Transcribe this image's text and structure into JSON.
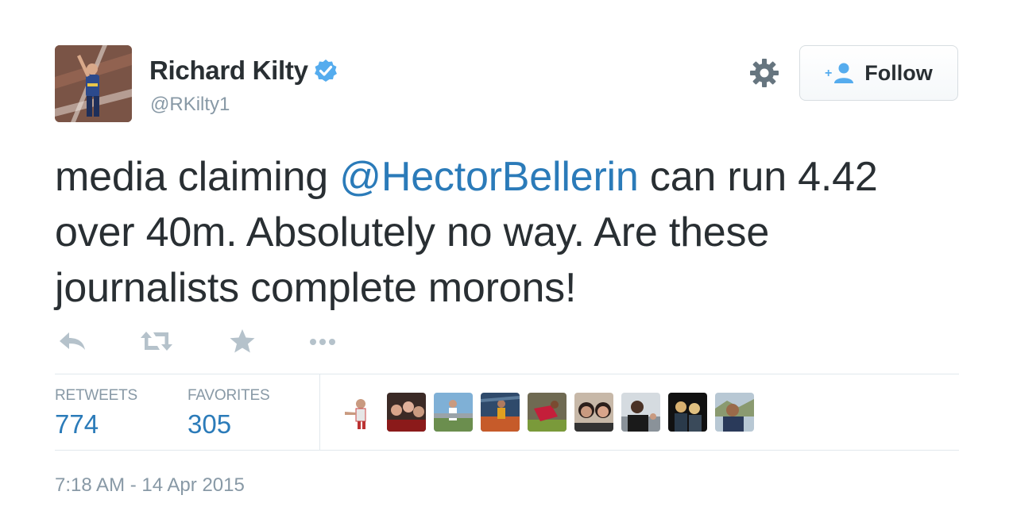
{
  "user": {
    "name": "Richard Kilty",
    "handle": "@RKilty1"
  },
  "follow_button": {
    "label": "Follow"
  },
  "tweet": {
    "text_before": "media claiming ",
    "mention": "@HectorBellerin",
    "text_after": " can run 4.42 over 40m. Absolutely no way. Are these journalists complete morons!"
  },
  "actions": [
    {
      "icon": "reply-icon"
    },
    {
      "icon": "retweet-icon"
    },
    {
      "icon": "favorite-star-icon"
    },
    {
      "icon": "more-options-icon"
    }
  ],
  "stats": {
    "retweets_label": "RETWEETS",
    "retweets_value": "774",
    "favorites_label": "FAVORITES",
    "favorites_value": "305"
  },
  "timestamp": "7:18 AM - 14 Apr 2015",
  "colors": {
    "text": "#292f33",
    "secondary": "#8899a6",
    "link": "#2b7bb9",
    "verified": "#55acee",
    "divider": "#e1e8ed"
  }
}
